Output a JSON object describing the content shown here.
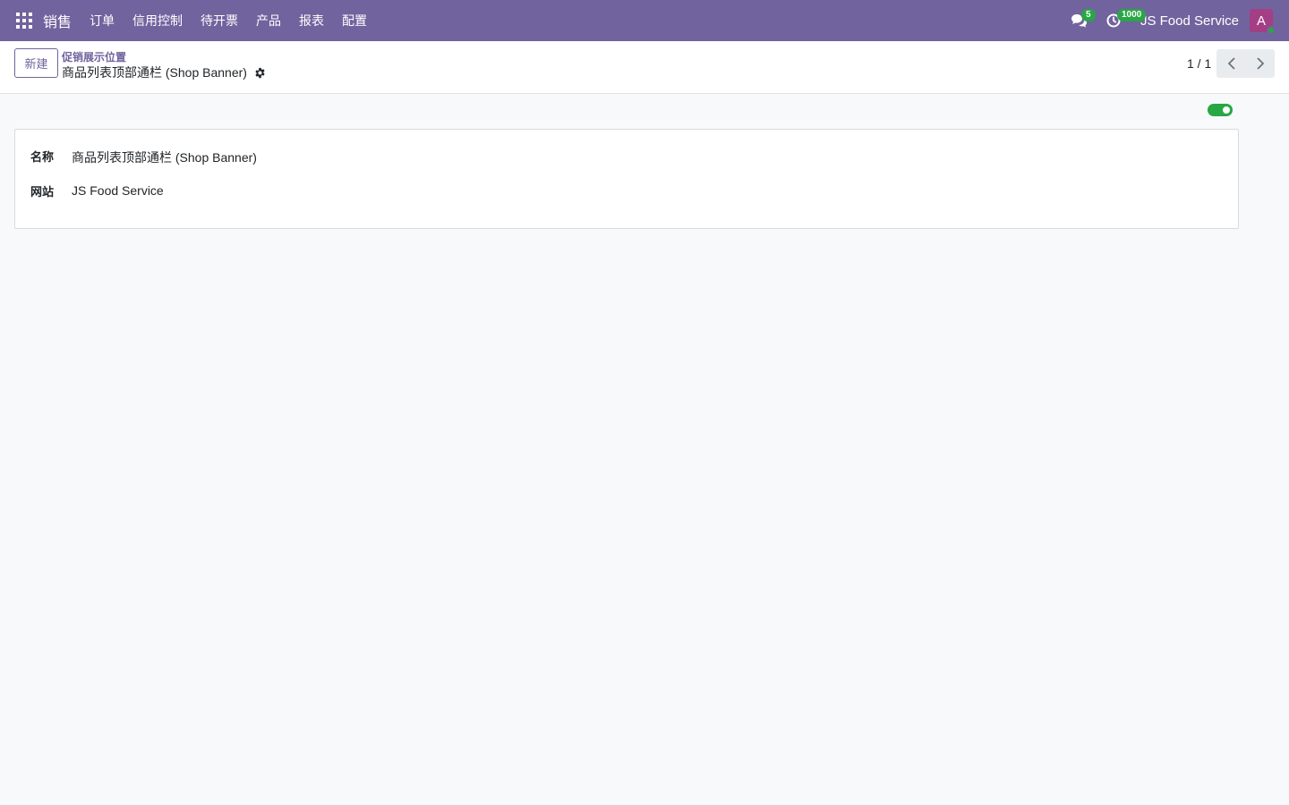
{
  "navbar": {
    "app_name": "销售",
    "menu": [
      "订单",
      "信用控制",
      "待开票",
      "产品",
      "报表",
      "配置"
    ],
    "messages_count": "5",
    "activities_count": "1000",
    "company": "JS Food Service",
    "avatar_letter": "A",
    "color": "#71639e"
  },
  "control_panel": {
    "new_label": "新建",
    "breadcrumb_parent": "促销展示位置",
    "breadcrumb_current": "商品列表顶部通栏 (Shop Banner)",
    "pager_value": "1 / 1"
  },
  "form": {
    "active": true,
    "fields": [
      {
        "label": "名称",
        "value": "商品列表顶部通栏 (Shop Banner)"
      },
      {
        "label": "网站",
        "value": "JS Food Service"
      }
    ]
  }
}
